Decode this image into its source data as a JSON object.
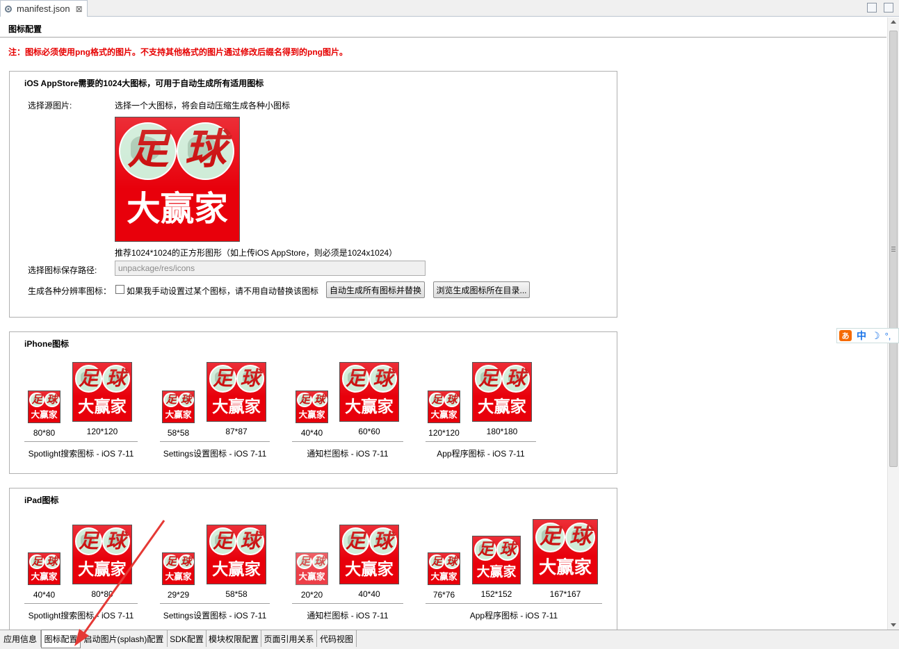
{
  "editor": {
    "tab_label": "manifest.json",
    "close_glyph": "⊠"
  },
  "section": {
    "title": "图标配置"
  },
  "notice": "注：图标必须使用png格式的图片。不支持其他格式的图片通过修改后缀名得到的png图片。",
  "icon_art": {
    "top": "足 球",
    "top_left": "足",
    "top_right": "球",
    "bottom": "大赢家"
  },
  "ios_group": {
    "title": "iOS AppStore需要的1024大图标，可用于自动生成所有适用图标",
    "source_label": "选择源图片:",
    "source_hint": "选择一个大图标，将会自动压缩生成各种小图标",
    "recommend": "推荐1024*1024的正方形图形（如上传iOS AppStore，则必须是1024x1024）",
    "path_label": "选择图标保存路径:",
    "path_value": "unpackage/res/icons",
    "resolution_label": "生成各种分辨率图标：",
    "checkbox_label": "如果我手动设置过某个图标，请不用自动替换该图标",
    "auto_button": "自动生成所有图标并替换",
    "browse_button": "浏览生成图标所在目录..."
  },
  "iphone_group": {
    "title": "iPhone图标",
    "sets": [
      {
        "sizes": [
          "80*80",
          "120*120"
        ],
        "caption": "Spotlight搜索图标 - iOS 7-11"
      },
      {
        "sizes": [
          "58*58",
          "87*87"
        ],
        "caption": "Settings设置图标 - iOS 7-11"
      },
      {
        "sizes": [
          "40*40",
          "60*60"
        ],
        "caption": "通知栏图标 - iOS 7-11"
      },
      {
        "sizes": [
          "120*120",
          "180*180"
        ],
        "caption": "App程序图标 - iOS 7-11"
      }
    ]
  },
  "ipad_group": {
    "title": "iPad图标",
    "sets": [
      {
        "sizes": [
          "40*40",
          "80*80"
        ],
        "caption": "Spotlight搜索图标 - iOS 7-11"
      },
      {
        "sizes": [
          "29*29",
          "58*58"
        ],
        "caption": "Settings设置图标 - iOS 7-11"
      },
      {
        "sizes": [
          "20*20",
          "40*40"
        ],
        "caption": "通知栏图标 - iOS 7-11"
      },
      {
        "sizes": [
          "76*76",
          "152*152",
          "167*167"
        ],
        "caption": "App程序图标 - iOS 7-11"
      }
    ]
  },
  "bottom_tabs": [
    "应用信息",
    "图标配置",
    "启动图片(splash)配置",
    "SDK配置",
    "模块权限配置",
    "页面引用关系",
    "代码视图"
  ],
  "ime": {
    "logo": "あ",
    "mode": "中",
    "moon": "☽",
    "dot": "°,"
  },
  "colors": {
    "notice": "#e60000",
    "icon_red": "#e8000b",
    "annotation_arrow": "#e53935"
  }
}
